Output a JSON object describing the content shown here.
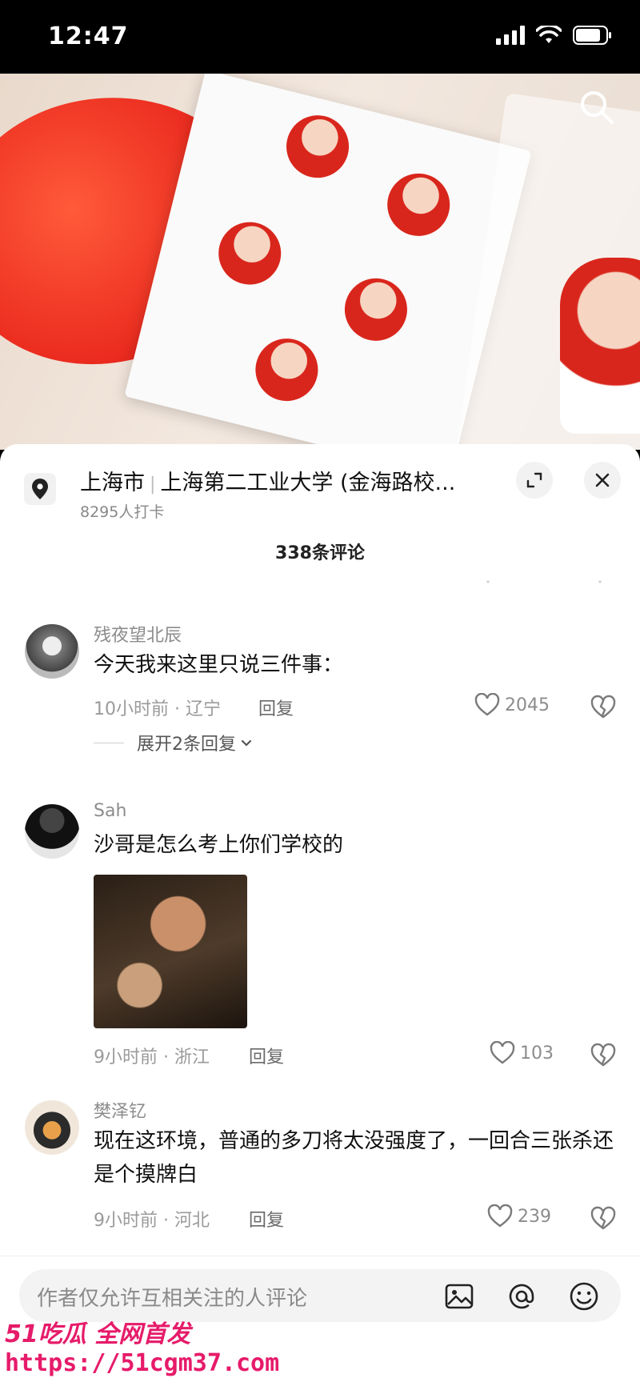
{
  "status_bar": {
    "time": "12:47"
  },
  "location": {
    "city": "上海市",
    "place": "上海第二工业大学 (金海路校...",
    "checkins": "8295人打卡"
  },
  "comments_header": {
    "count_label": "338条评论"
  },
  "comments": [
    {
      "username": "残夜望北辰",
      "text": "今天我来这里只说三件事：",
      "meta": "10小时前 · 辽宁",
      "reply_label": "回复",
      "likes": "2045",
      "expand_label": "展开2条回复"
    },
    {
      "username": "Sah",
      "text": "沙哥是怎么考上你们学校的",
      "meta": "9小时前 · 浙江",
      "reply_label": "回复",
      "likes": "103"
    },
    {
      "username": "樊泽钇",
      "text": "现在这环境，普通的多刀将太没强度了，一回合三张杀还是个摸牌白",
      "meta": "9小时前 · 河北",
      "reply_label": "回复",
      "likes": "239"
    }
  ],
  "input": {
    "placeholder": "作者仅允许互相关注的人评论"
  },
  "watermark": {
    "logo": "51吃瓜 全网首发",
    "url": "https://51cgm37.com"
  },
  "icons": {
    "search": "search-icon",
    "location": "location-pin-icon",
    "expand": "expand-icon",
    "close": "close-icon",
    "like": "heart-icon",
    "dislike": "broken-heart-icon",
    "image": "image-icon",
    "mention": "at-icon",
    "emoji": "emoji-icon"
  },
  "colors": {
    "accent_red": "#e8251b",
    "watermark": "#e61b6a"
  }
}
